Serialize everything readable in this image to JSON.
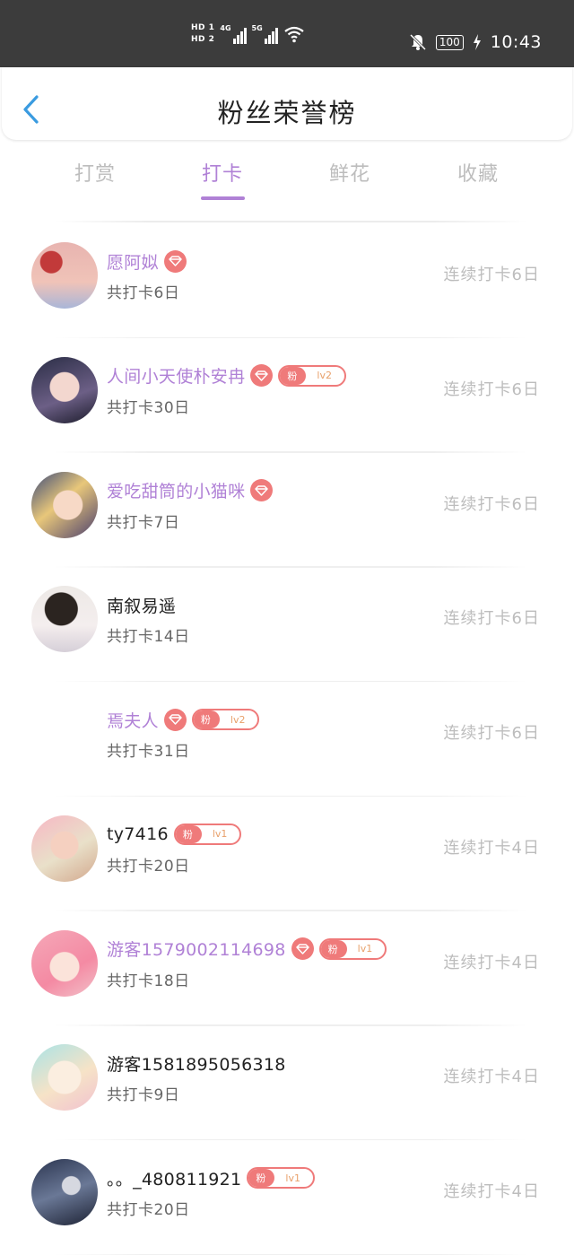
{
  "status_bar": {
    "sim1": "HD 1",
    "sim2": "HD 2",
    "net1": "4G",
    "net2": "5G",
    "battery": "100",
    "time": "10:43"
  },
  "header": {
    "title": "粉丝荣誉榜",
    "back_icon": "chevron-left-icon"
  },
  "tabs": [
    {
      "label": "打赏",
      "active": false
    },
    {
      "label": "打卡",
      "active": true
    },
    {
      "label": "鲜花",
      "active": false
    },
    {
      "label": "收藏",
      "active": false
    }
  ],
  "colors": {
    "accent": "#b081d6",
    "badge": "#ef7a7a",
    "muted": "#bdbdbd",
    "status_bar": "#3c3c3c"
  },
  "users": [
    {
      "name": "愿阿姒",
      "vip": true,
      "gem": true,
      "fan_label": "",
      "fan_level": "",
      "total": "共打卡6日",
      "streak": "连续打卡6日"
    },
    {
      "name": "人间小天使朴安冉",
      "vip": true,
      "gem": true,
      "fan_label": "粉",
      "fan_level": "lv2",
      "total": "共打卡30日",
      "streak": "连续打卡6日"
    },
    {
      "name": "爱吃甜筒的小猫咪",
      "vip": true,
      "gem": true,
      "fan_label": "",
      "fan_level": "",
      "total": "共打卡7日",
      "streak": "连续打卡6日"
    },
    {
      "name": "南叙易遥",
      "vip": false,
      "gem": false,
      "fan_label": "",
      "fan_level": "",
      "total": "共打卡14日",
      "streak": "连续打卡6日"
    },
    {
      "name": "焉夫人",
      "vip": true,
      "gem": true,
      "fan_label": "粉",
      "fan_level": "lv2",
      "total": "共打卡31日",
      "streak": "连续打卡6日"
    },
    {
      "name": "ty7416",
      "vip": false,
      "gem": false,
      "fan_label": "粉",
      "fan_level": "lv1",
      "total": "共打卡20日",
      "streak": "连续打卡4日"
    },
    {
      "name": "游客1579002114698",
      "vip": true,
      "gem": true,
      "fan_label": "粉",
      "fan_level": "lv1",
      "total": "共打卡18日",
      "streak": "连续打卡4日"
    },
    {
      "name": "游客1581895056318",
      "vip": false,
      "gem": false,
      "fan_label": "",
      "fan_level": "",
      "total": "共打卡9日",
      "streak": "连续打卡4日"
    },
    {
      "name": "。。_480811921",
      "vip": false,
      "gem": false,
      "fan_label": "粉",
      "fan_level": "lv1",
      "total": "共打卡20日",
      "streak": "连续打卡4日"
    }
  ]
}
